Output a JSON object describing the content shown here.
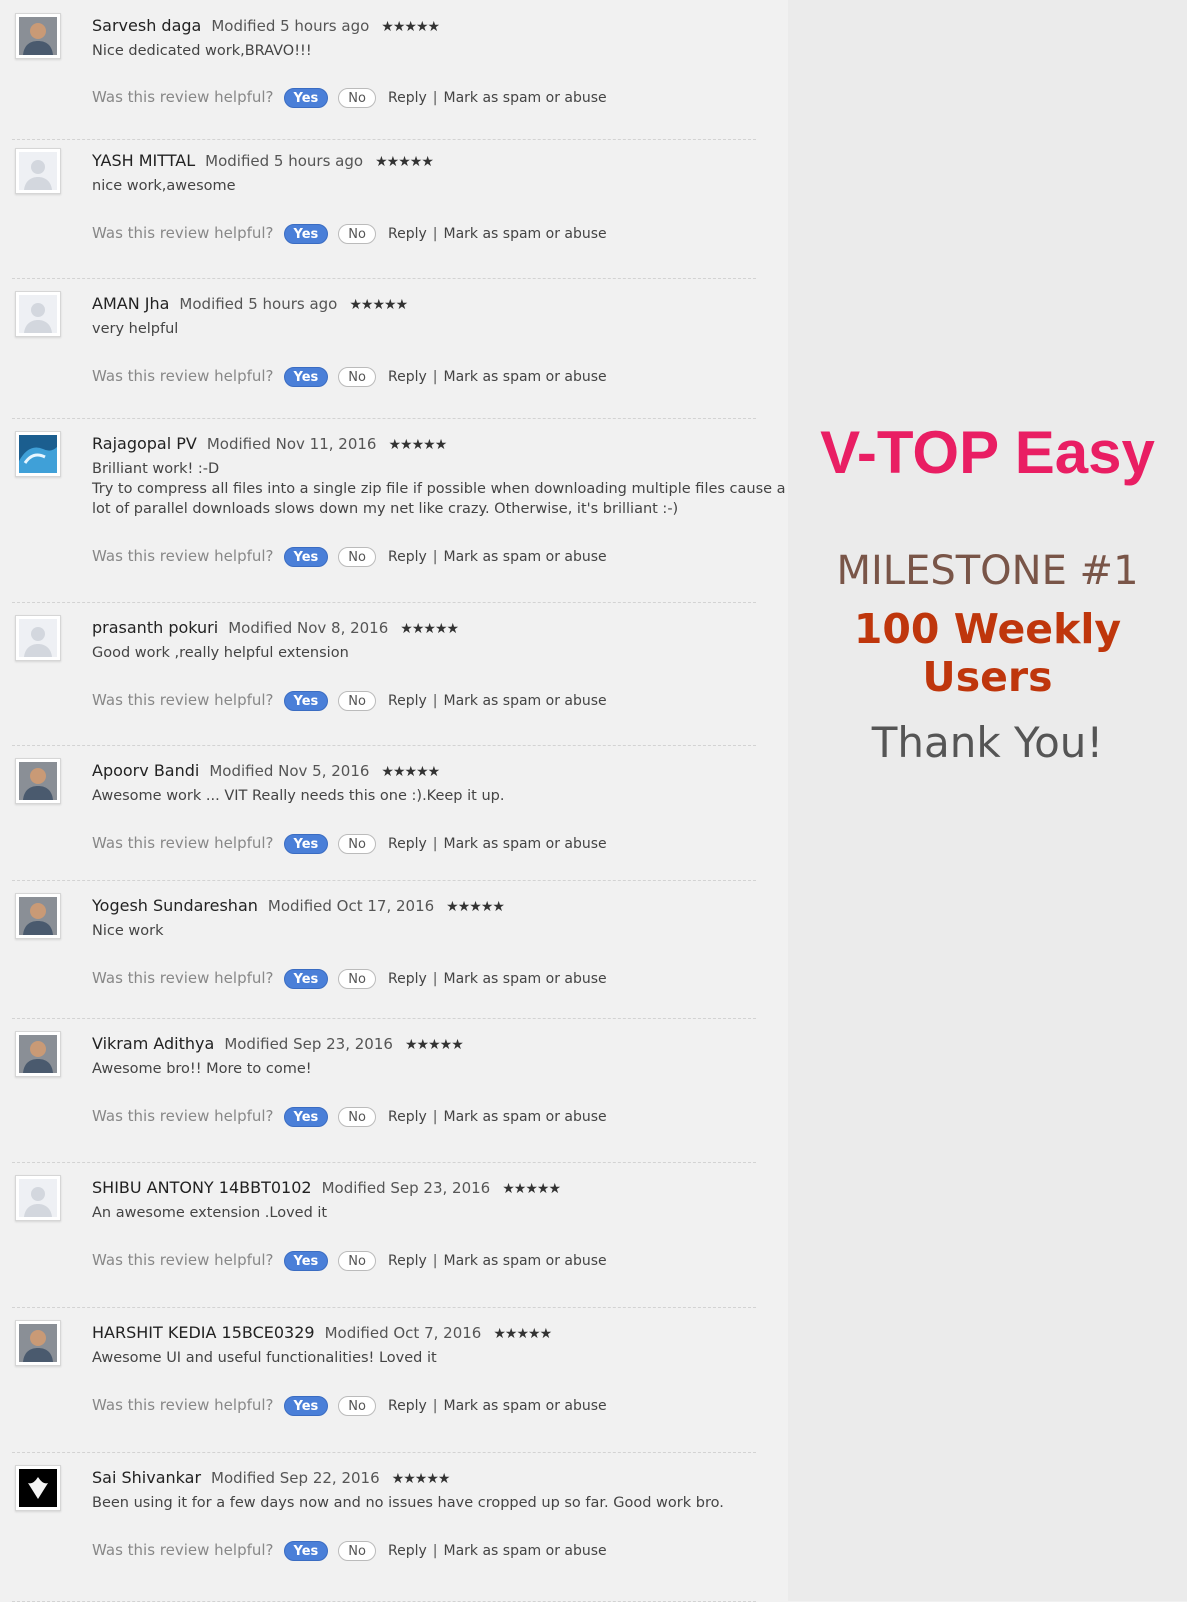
{
  "labels": {
    "helpful_question": "Was this review helpful?",
    "yes": "Yes",
    "no": "No",
    "reply": "Reply",
    "separator": "|",
    "spam": "Mark as spam or abuse"
  },
  "reviews": [
    {
      "author": "Sarvesh daga",
      "modified": "Modified 5 hours ago",
      "rating": 5,
      "body": [
        "Nice dedicated work,BRAVO!!!"
      ],
      "avatar": "photo"
    },
    {
      "author": "YASH MITTAL",
      "modified": "Modified 5 hours ago",
      "rating": 5,
      "body": [
        "nice work,awesome"
      ],
      "avatar": "placeholder"
    },
    {
      "author": "AMAN Jha",
      "modified": "Modified 5 hours ago",
      "rating": 5,
      "body": [
        "very helpful"
      ],
      "avatar": "placeholder"
    },
    {
      "author": "Rajagopal PV",
      "modified": "Modified Nov 11, 2016",
      "rating": 5,
      "body": [
        "Brilliant work! :-D",
        "Try to compress all files into a single zip file if possible when downloading multiple files cause a",
        "lot of parallel downloads slows down my net like crazy. Otherwise, it's brilliant :-)"
      ],
      "avatar": "wave"
    },
    {
      "author": "prasanth pokuri",
      "modified": "Modified Nov 8, 2016",
      "rating": 5,
      "body": [
        "Good work ,really helpful extension"
      ],
      "avatar": "placeholder"
    },
    {
      "author": "Apoorv Bandi",
      "modified": "Modified Nov 5, 2016",
      "rating": 5,
      "body": [
        "Awesome work ... VIT Really needs this one :).Keep it up."
      ],
      "avatar": "photo"
    },
    {
      "author": "Yogesh Sundareshan",
      "modified": "Modified Oct 17, 2016",
      "rating": 5,
      "body": [
        "Nice work"
      ],
      "avatar": "photo"
    },
    {
      "author": "Vikram Adithya",
      "modified": "Modified Sep 23, 2016",
      "rating": 5,
      "body": [
        "Awesome bro!! More to come!"
      ],
      "avatar": "photo"
    },
    {
      "author": "SHIBU ANTONY 14BBT0102",
      "modified": "Modified Sep 23, 2016",
      "rating": 5,
      "body": [
        "An awesome extension .Loved it"
      ],
      "avatar": "placeholder"
    },
    {
      "author": "HARSHIT KEDIA 15BCE0329",
      "modified": "Modified Oct 7, 2016",
      "rating": 5,
      "body": [
        "Awesome UI and useful functionalities! Loved it"
      ],
      "avatar": "photo"
    },
    {
      "author": "Sai Shivankar",
      "modified": "Modified Sep 22, 2016",
      "rating": 5,
      "body": [
        "Been using it for a few days now and no issues have cropped up so far. Good work bro."
      ],
      "avatar": "flower"
    }
  ],
  "side": {
    "title": "V-TOP Easy",
    "milestone": "MILESTONE #1",
    "users": "100 Weekly Users",
    "thanks": "Thank You!"
  }
}
